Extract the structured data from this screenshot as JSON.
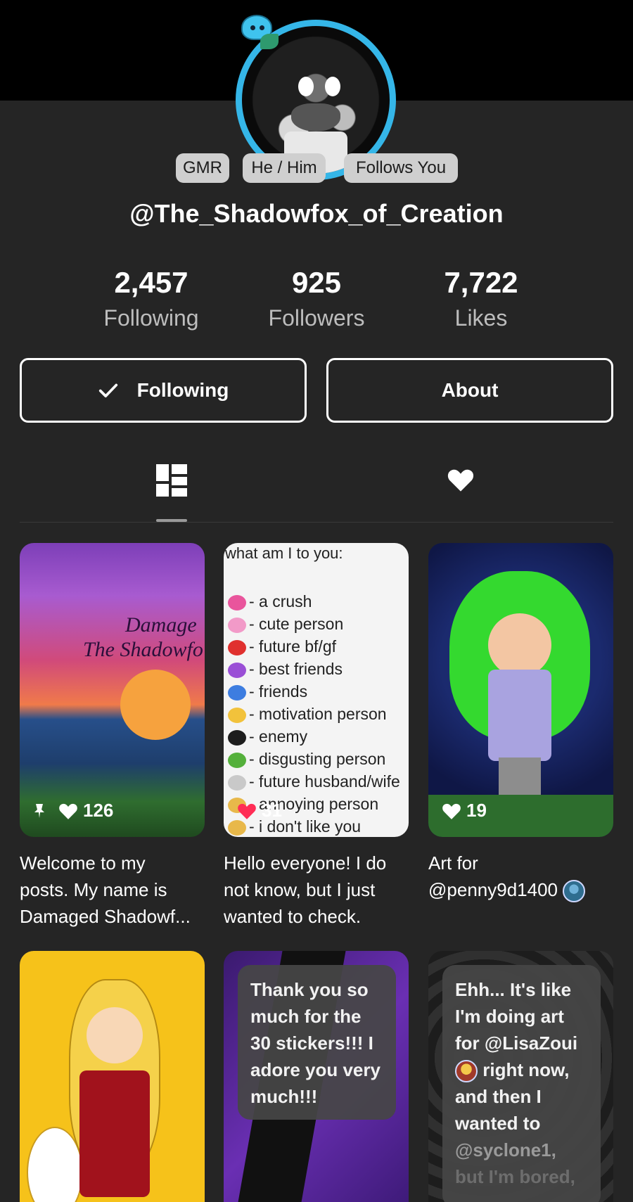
{
  "profile": {
    "pronoun_pills": [
      "GMR",
      "He / Him",
      "Follows You"
    ],
    "handle": "@The_Shadowfox_of_Creation"
  },
  "stats": [
    {
      "value": "2,457",
      "label": "Following"
    },
    {
      "value": "925",
      "label": "Followers"
    },
    {
      "value": "7,722",
      "label": "Likes"
    }
  ],
  "actions": {
    "following_label": "Following",
    "about_label": "About"
  },
  "tabs": [
    {
      "name": "posts",
      "icon": "grid-icon",
      "selected": true
    },
    {
      "name": "liked",
      "icon": "heart-icon",
      "selected": false
    }
  ],
  "posts": [
    {
      "pinned": true,
      "likes": "126",
      "art_text": [
        "Damage",
        "The Shadowfo"
      ],
      "caption": [
        "Welcome to my",
        "posts. My name is",
        "Damaged Shadowf..."
      ]
    },
    {
      "likes": "31",
      "art_head": "what am I to you:",
      "art_rows": [
        {
          "text": "- a crush",
          "color": "#e9559c"
        },
        {
          "text": "- cute person",
          "color": "#f29ac8"
        },
        {
          "text": "- future bf/gf",
          "color": "#e0302e"
        },
        {
          "text": "- best friends",
          "color": "#9a4fd6"
        },
        {
          "text": "- friends",
          "color": "#3d7de0"
        },
        {
          "text": "- motivation person",
          "color": "#f2c23b"
        },
        {
          "text": "- enemy",
          "color": "#1d1d1d"
        },
        {
          "text": "- disgusting person",
          "color": "#54b03b"
        },
        {
          "text": "- future husband/wife",
          "color": "#c9c9c9"
        },
        {
          "text": "- annoying person",
          "color": "#e8b84a"
        },
        {
          "text": "- i don't like you",
          "color": "#e8b84a"
        }
      ],
      "caption": [
        "Hello everyone! I do",
        "not know, but I just",
        "wanted to check."
      ]
    },
    {
      "likes": "19",
      "caption": [
        "Art for",
        "@penny9d1400"
      ]
    },
    {
      "bubble": []
    },
    {
      "bubble": [
        "Thank you so",
        "much for the",
        "30 stickers!!! I",
        "adore you very",
        "much!!!"
      ]
    },
    {
      "bubble": [
        "Ehh... It's like",
        "I'm doing art",
        "for @LisaZoui",
        "right now,",
        "and then I",
        "wanted to",
        "@syclone1,",
        "but I'm bored,"
      ]
    }
  ]
}
